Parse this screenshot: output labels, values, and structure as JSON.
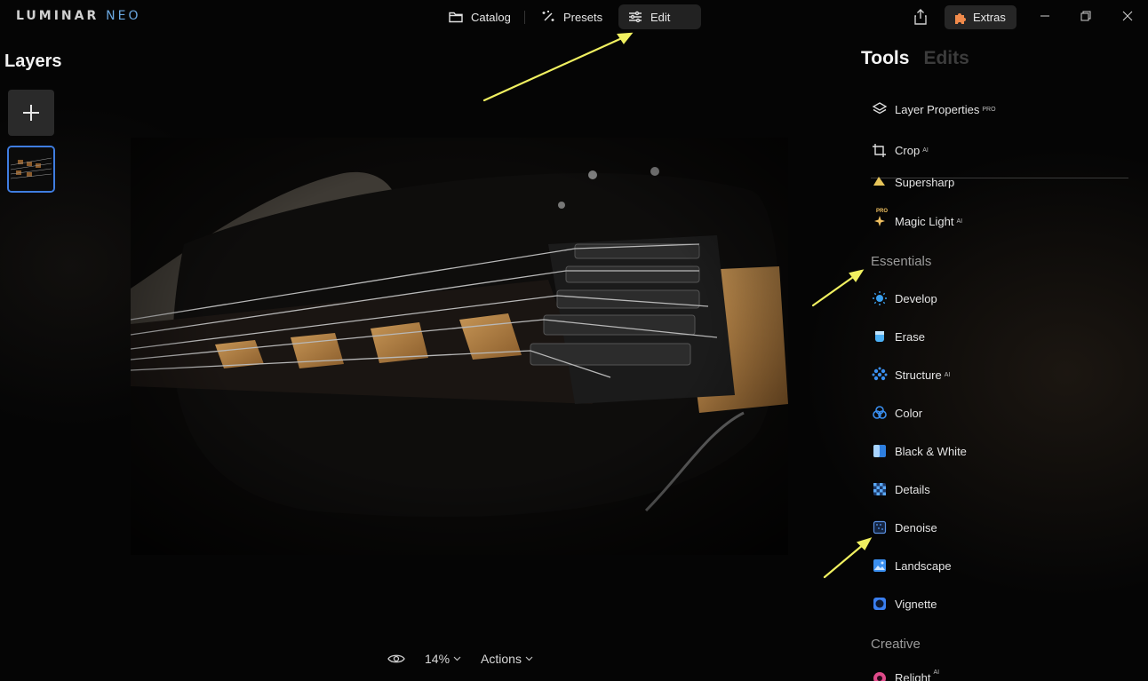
{
  "app": {
    "logo_main": "LUMINAR",
    "logo_accent": "NEO"
  },
  "topnav": {
    "catalog": "Catalog",
    "presets": "Presets",
    "edit": "Edit",
    "extras": "Extras"
  },
  "layers": {
    "title": "Layers"
  },
  "tabs": {
    "tools": "Tools",
    "edits": "Edits"
  },
  "tools": {
    "layer_properties": {
      "label": "Layer Properties",
      "badge": "PRO"
    },
    "crop": {
      "label": "Crop",
      "badge": "AI"
    },
    "supersharp": {
      "label": "Supersharp"
    },
    "magic_light": {
      "label": "Magic Light",
      "badge": "AI",
      "icon_badge": "PRO"
    },
    "essentials_title": "Essentials",
    "develop": {
      "label": "Develop"
    },
    "erase": {
      "label": "Erase"
    },
    "structure": {
      "label": "Structure",
      "badge": "AI"
    },
    "color": {
      "label": "Color"
    },
    "black_white": {
      "label": "Black & White"
    },
    "details": {
      "label": "Details"
    },
    "denoise": {
      "label": "Denoise"
    },
    "landscape": {
      "label": "Landscape"
    },
    "vignette": {
      "label": "Vignette"
    },
    "creative_title": "Creative",
    "relight": {
      "label": "Relight",
      "badge": "AI"
    }
  },
  "bottombar": {
    "zoom": "14%",
    "actions": "Actions"
  },
  "colors": {
    "accent_blue": "#3f7de0",
    "annotation_yellow": "#f0f060",
    "extras_orange": "#f08a4b"
  }
}
